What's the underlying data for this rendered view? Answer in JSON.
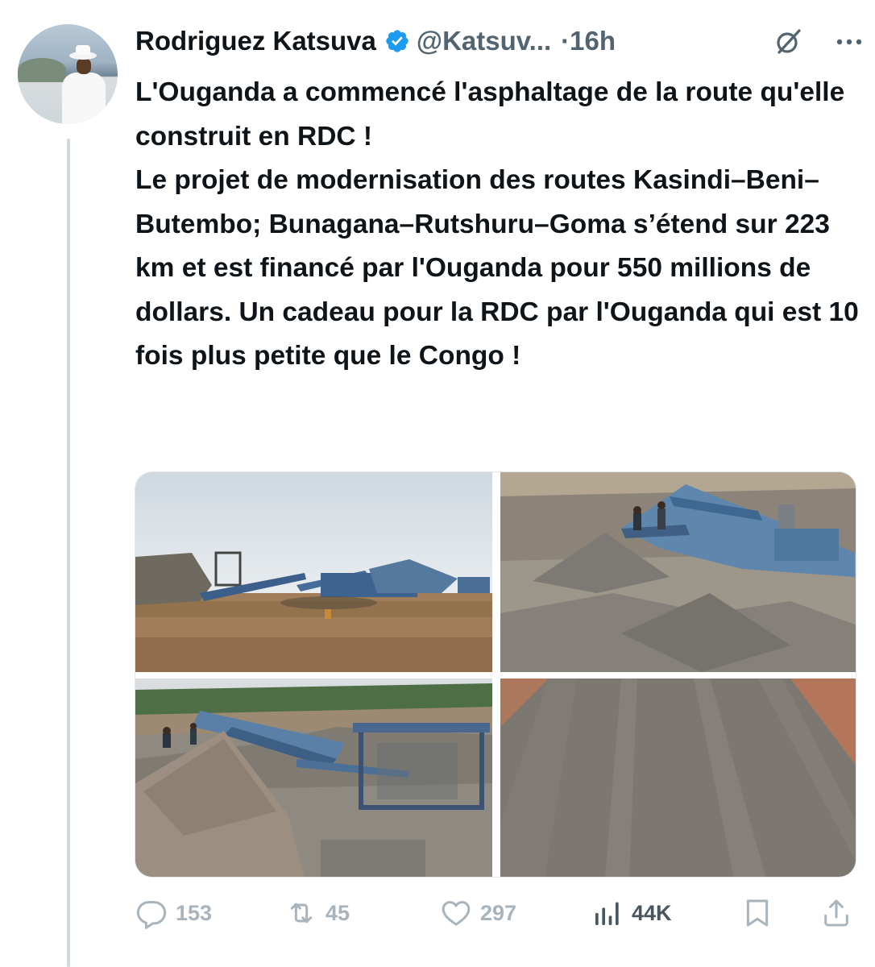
{
  "tweet": {
    "author_name": "Rodriguez Katsuva",
    "author_handle": "@Katsuv...",
    "separator": "·",
    "time": "16h",
    "text_lines": [
      "L'Ouganda a commencé l'asphaltage de la route qu'elle construit en RDC !",
      "Le projet de modernisation des routes Kasindi–Beni–Butembo; Bunagana–Rutshuru–Goma s’étend sur 223 km et est financé par l'Ouganda pour 550 millions de dollars. Un cadeau pour la RDC par l'Ouganda qui est 10 fois plus petite que le Congo !"
    ]
  },
  "media": [
    {
      "scene": "mobile crushing plant on dirt site under cloudy sky"
    },
    {
      "scene": "workers on screening machine above gravel piles"
    },
    {
      "scene": "crusher and conveyor in quarry with green hills"
    },
    {
      "scene": "freshly graded gravel road with tyre tracks"
    }
  ],
  "actions": {
    "reply_count": "153",
    "retweet_count": "45",
    "like_count": "297",
    "view_count": "44K"
  },
  "icons": {
    "verified": "verified-badge-icon",
    "grok": "grok-icon",
    "more": "more-icon",
    "reply": "reply-icon",
    "retweet": "retweet-icon",
    "like": "heart-icon",
    "views": "views-chart-icon",
    "bookmark": "bookmark-icon",
    "share": "share-icon"
  },
  "colors": {
    "verified_blue": "#1d9bf0",
    "secondary_text": "#536471",
    "action_muted": "#a8b3bb",
    "thread_line": "#cfd9de"
  }
}
